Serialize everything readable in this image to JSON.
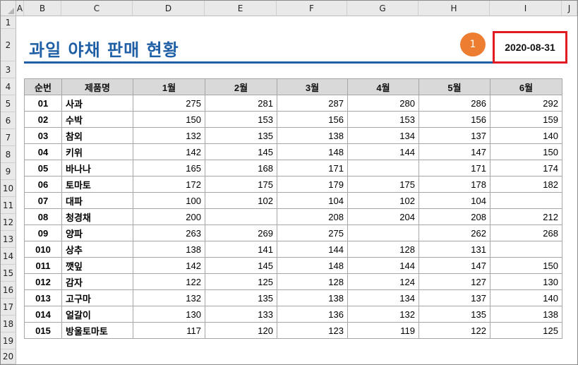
{
  "columns": [
    "A",
    "B",
    "C",
    "D",
    "E",
    "F",
    "G",
    "H",
    "I",
    "J"
  ],
  "rows": [
    "1",
    "2",
    "3",
    "4",
    "5",
    "6",
    "7",
    "8",
    "9",
    "10",
    "11",
    "12",
    "13",
    "14",
    "15",
    "16",
    "17",
    "18",
    "19",
    "20"
  ],
  "title": "과일 야채 판매 현황",
  "badge": "1",
  "date": "2020-08-31",
  "table": {
    "headers": [
      "순번",
      "제품명",
      "1월",
      "2월",
      "3월",
      "4월",
      "5월",
      "6월"
    ],
    "rows": [
      [
        "01",
        "사과",
        "275",
        "281",
        "287",
        "280",
        "286",
        "292"
      ],
      [
        "02",
        "수박",
        "150",
        "153",
        "156",
        "153",
        "156",
        "159"
      ],
      [
        "03",
        "참외",
        "132",
        "135",
        "138",
        "134",
        "137",
        "140"
      ],
      [
        "04",
        "키위",
        "142",
        "145",
        "148",
        "144",
        "147",
        "150"
      ],
      [
        "05",
        "바나나",
        "165",
        "168",
        "171",
        "",
        "171",
        "174"
      ],
      [
        "06",
        "토마토",
        "172",
        "175",
        "179",
        "175",
        "178",
        "182"
      ],
      [
        "07",
        "대파",
        "100",
        "102",
        "104",
        "102",
        "104",
        ""
      ],
      [
        "08",
        "청경채",
        "200",
        "",
        "208",
        "204",
        "208",
        "212"
      ],
      [
        "09",
        "양파",
        "263",
        "269",
        "275",
        "",
        "262",
        "268"
      ],
      [
        "010",
        "상추",
        "138",
        "141",
        "144",
        "128",
        "131",
        ""
      ],
      [
        "011",
        "깻잎",
        "142",
        "145",
        "148",
        "144",
        "147",
        "150"
      ],
      [
        "012",
        "감자",
        "122",
        "125",
        "128",
        "124",
        "127",
        "130"
      ],
      [
        "013",
        "고구마",
        "132",
        "135",
        "138",
        "134",
        "137",
        "140"
      ],
      [
        "014",
        "얼갈이",
        "130",
        "133",
        "136",
        "132",
        "135",
        "138"
      ],
      [
        "015",
        "방울토마토",
        "117",
        "120",
        "123",
        "119",
        "122",
        "125"
      ]
    ]
  }
}
